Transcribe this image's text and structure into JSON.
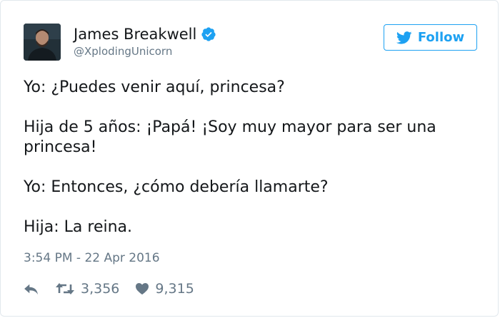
{
  "author": {
    "display_name": "James Breakwell",
    "handle": "@XplodingUnicorn",
    "verified": true
  },
  "follow_button": {
    "label": "Follow"
  },
  "tweet": {
    "lines": [
      "Yo: ¿Puedes venir aquí, princesa?",
      "Hija de 5 años: ¡Papá! ¡Soy muy mayor para ser una princesa!",
      "Yo: Entonces, ¿cómo debería llamarte?",
      "Hija: La reina."
    ],
    "timestamp": "3:54 PM - 22 Apr 2016"
  },
  "actions": {
    "retweets": "3,356",
    "likes": "9,315"
  },
  "colors": {
    "accent": "#1da1f2",
    "muted": "#657786",
    "text": "#14171a",
    "border": "#e1e8ed"
  },
  "icons": {
    "avatar": "profile-photo",
    "verified": "verified-badge-icon",
    "follow": "twitter-bird-icon",
    "reply": "reply-icon",
    "retweet": "retweet-icon",
    "like": "heart-icon"
  }
}
